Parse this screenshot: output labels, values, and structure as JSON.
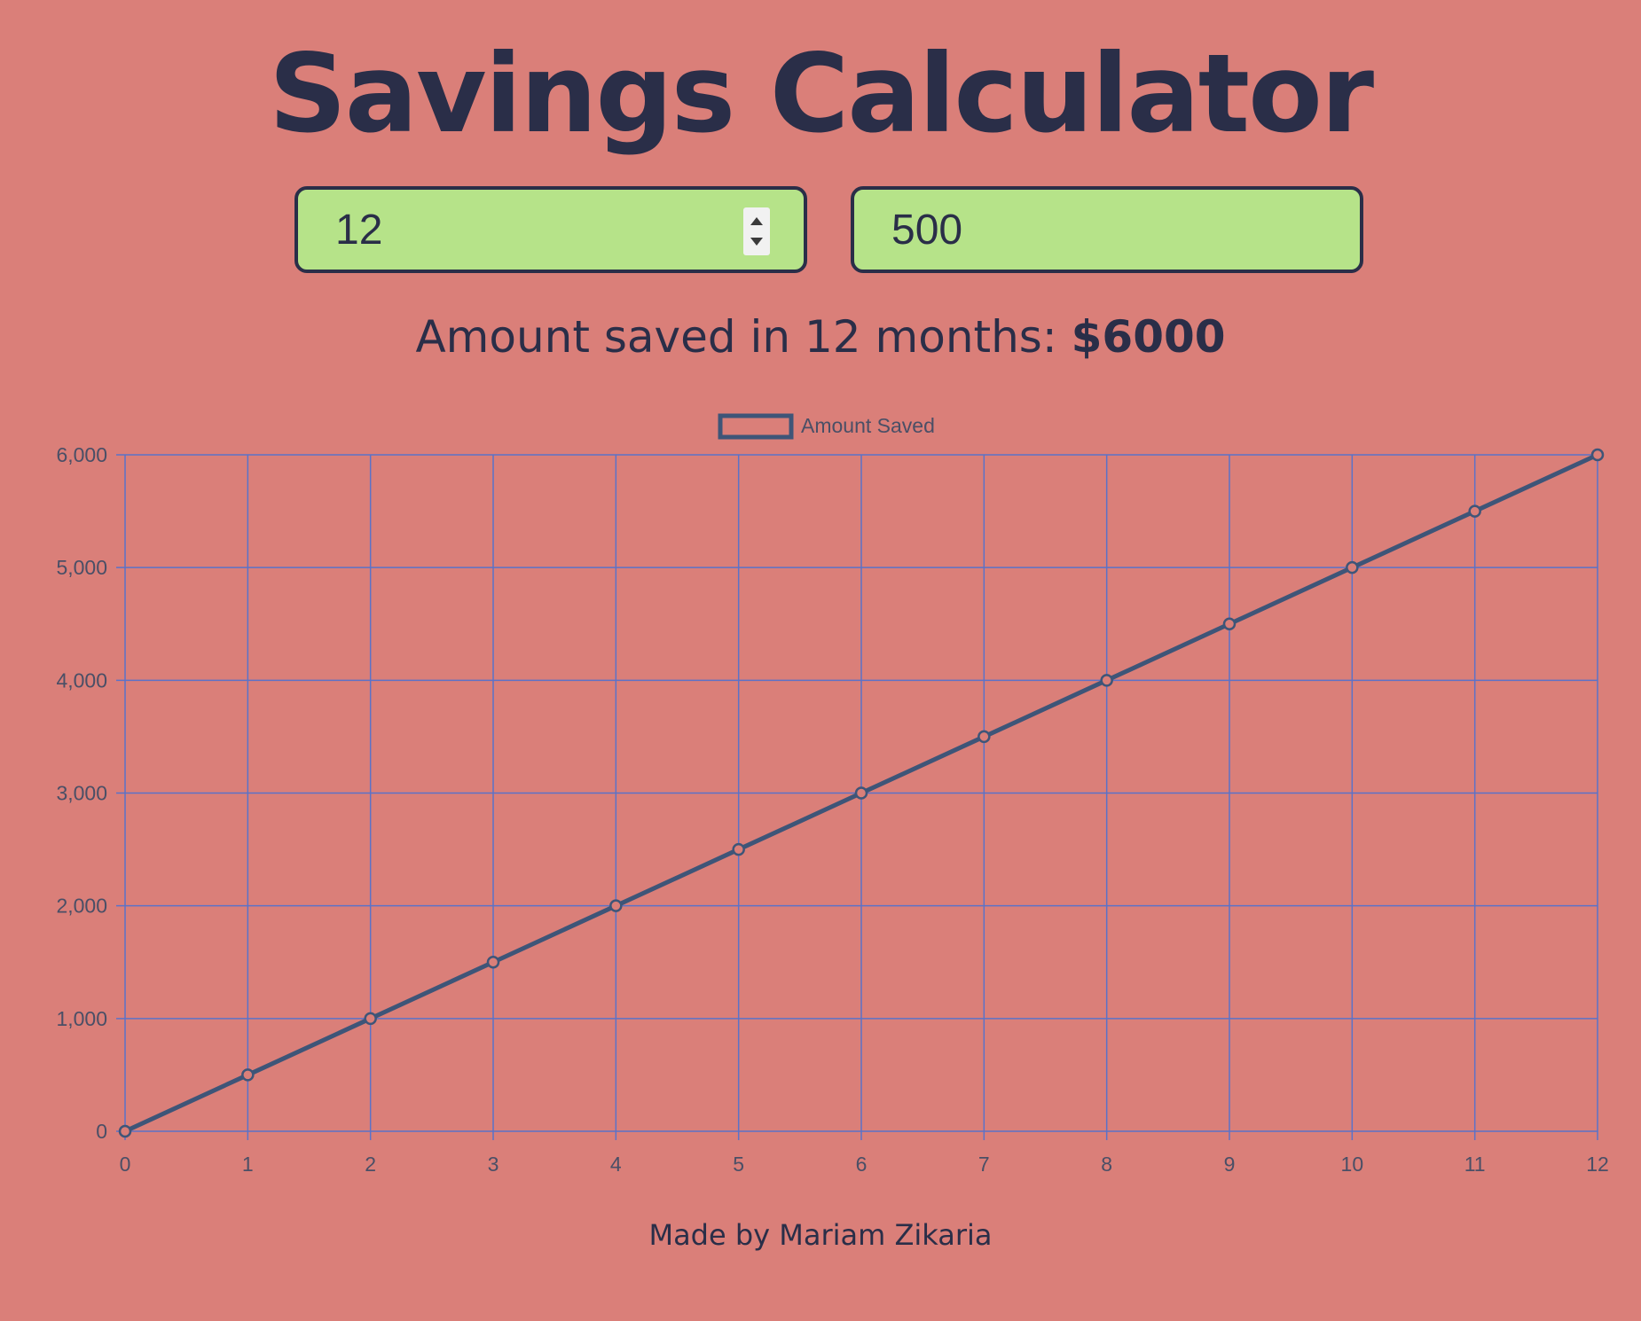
{
  "page": {
    "title": "Savings Calculator",
    "months_value": "12",
    "monthly_amount_value": "500",
    "result_prefix": "Amount saved in",
    "result_months": "12",
    "result_suffix": "months:",
    "result_amount": "$6000",
    "footer": "Made by Mariam Zikaria"
  },
  "colors": {
    "background": "#da7f79",
    "text": "#2a2e48",
    "input_bg": "#b6e389",
    "grid": "#5b72c8",
    "line": "#3e5578"
  },
  "chart_data": {
    "type": "line",
    "x": [
      0,
      1,
      2,
      3,
      4,
      5,
      6,
      7,
      8,
      9,
      10,
      11,
      12
    ],
    "series": [
      {
        "name": "Amount Saved",
        "values": [
          0,
          500,
          1000,
          1500,
          2000,
          2500,
          3000,
          3500,
          4000,
          4500,
          5000,
          5500,
          6000
        ]
      }
    ],
    "x_tick_labels": [
      "0",
      "1",
      "2",
      "3",
      "4",
      "5",
      "6",
      "7",
      "8",
      "9",
      "10",
      "11",
      "12"
    ],
    "y_ticks": [
      0,
      1000,
      2000,
      3000,
      4000,
      5000,
      6000
    ],
    "y_tick_labels": [
      "0",
      "1,000",
      "2,000",
      "3,000",
      "4,000",
      "5,000",
      "6,000"
    ],
    "xlim": [
      0,
      12
    ],
    "ylim": [
      0,
      6000
    ],
    "grid": true,
    "legend": "top-center"
  }
}
